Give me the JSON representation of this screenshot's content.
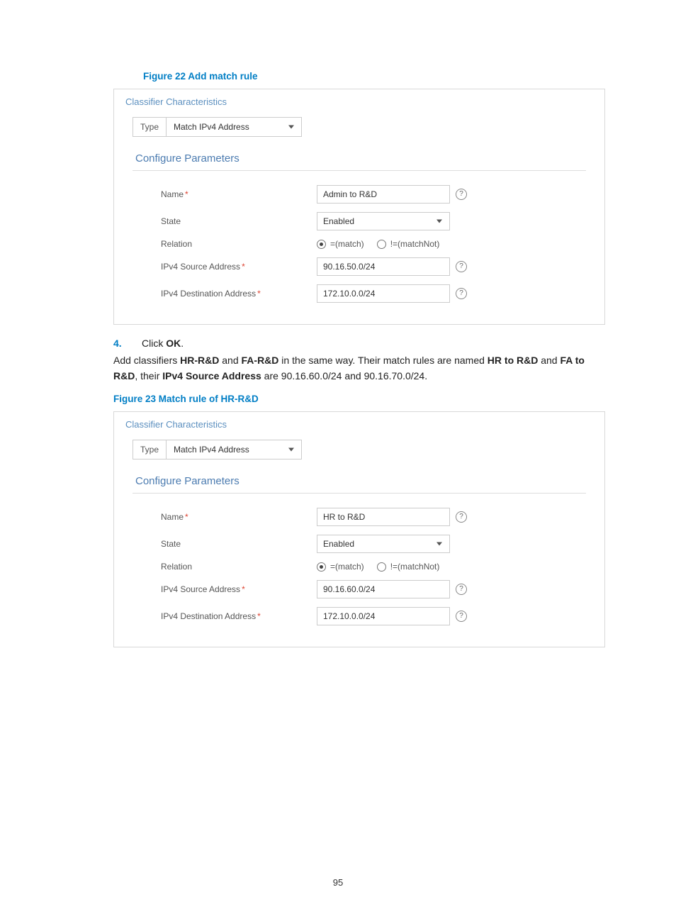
{
  "page_number": "95",
  "figure22": {
    "caption": "Figure 22 Add match rule",
    "panel_title": "Classifier Characteristics",
    "type_label": "Type",
    "type_value": "Match IPv4 Address",
    "section_title": "Configure Parameters",
    "labels": {
      "name": "Name",
      "state": "State",
      "relation": "Relation",
      "src": "IPv4 Source Address",
      "dst": "IPv4 Destination Address"
    },
    "values": {
      "name": "Admin to R&D",
      "state": "Enabled",
      "relation_match": "=(match)",
      "relation_not": "!=(matchNot)",
      "src": "90.16.50.0/24",
      "dst": "172.10.0.0/24"
    }
  },
  "step4": {
    "num": "4.",
    "prefix": "Click ",
    "bold": "OK",
    "suffix": "."
  },
  "para": {
    "t1": "Add classifiers ",
    "b1": "HR-R&D",
    "t2": " and ",
    "b2": "FA-R&D",
    "t3": " in the same way. Their match rules are named ",
    "b3": "HR to R&D",
    "t4": " and ",
    "b4": "FA to R&D",
    "t5": ", their ",
    "b5": "IPv4 Source Address",
    "t6": " are 90.16.60.0/24 and 90.16.70.0/24."
  },
  "figure23": {
    "caption": "Figure 23 Match rule of HR-R&D",
    "panel_title": "Classifier Characteristics",
    "type_label": "Type",
    "type_value": "Match IPv4 Address",
    "section_title": "Configure Parameters",
    "labels": {
      "name": "Name",
      "state": "State",
      "relation": "Relation",
      "src": "IPv4 Source Address",
      "dst": "IPv4 Destination Address"
    },
    "values": {
      "name": "HR to R&D",
      "state": "Enabled",
      "relation_match": "=(match)",
      "relation_not": "!=(matchNot)",
      "src": "90.16.60.0/24",
      "dst": "172.10.0.0/24"
    }
  }
}
